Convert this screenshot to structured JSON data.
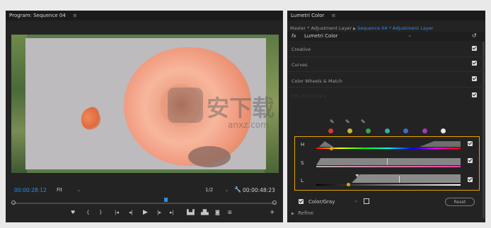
{
  "program": {
    "title": "Program: Sequence 04",
    "timecode_current": "00:00:28:12",
    "fit": "Fit",
    "resolution": "1/2",
    "timecode_total": "00:00:48:23"
  },
  "lumetri": {
    "title": "Lumetri Color",
    "breadcrumb_master": "Master * Adjustment Layer",
    "breadcrumb_arrow": "▶",
    "breadcrumb_seq": "Sequence 04 * Adjustment Layer",
    "fx_label": "fx",
    "effect_name": "Lumetri Color",
    "sections": [
      "Creative",
      "Curves",
      "Color Wheels & Match",
      "HSL Secondary"
    ],
    "key_labels": [
      "H",
      "S",
      "L"
    ],
    "color_gray_label": "Color/Gray",
    "reset_label": "Reset",
    "refine_label": "Refine"
  },
  "swatches": [
    "#d93a34",
    "#c8b43a",
    "#3aa64a",
    "#2fb0a0",
    "#3c6ec8",
    "#a03cb8",
    "#e8e8e8"
  ],
  "colors": {
    "accent": "#2d8ceb",
    "highlight": "#e8a200"
  },
  "watermark": {
    "text": "安下载",
    "sub": "anxz.com"
  }
}
